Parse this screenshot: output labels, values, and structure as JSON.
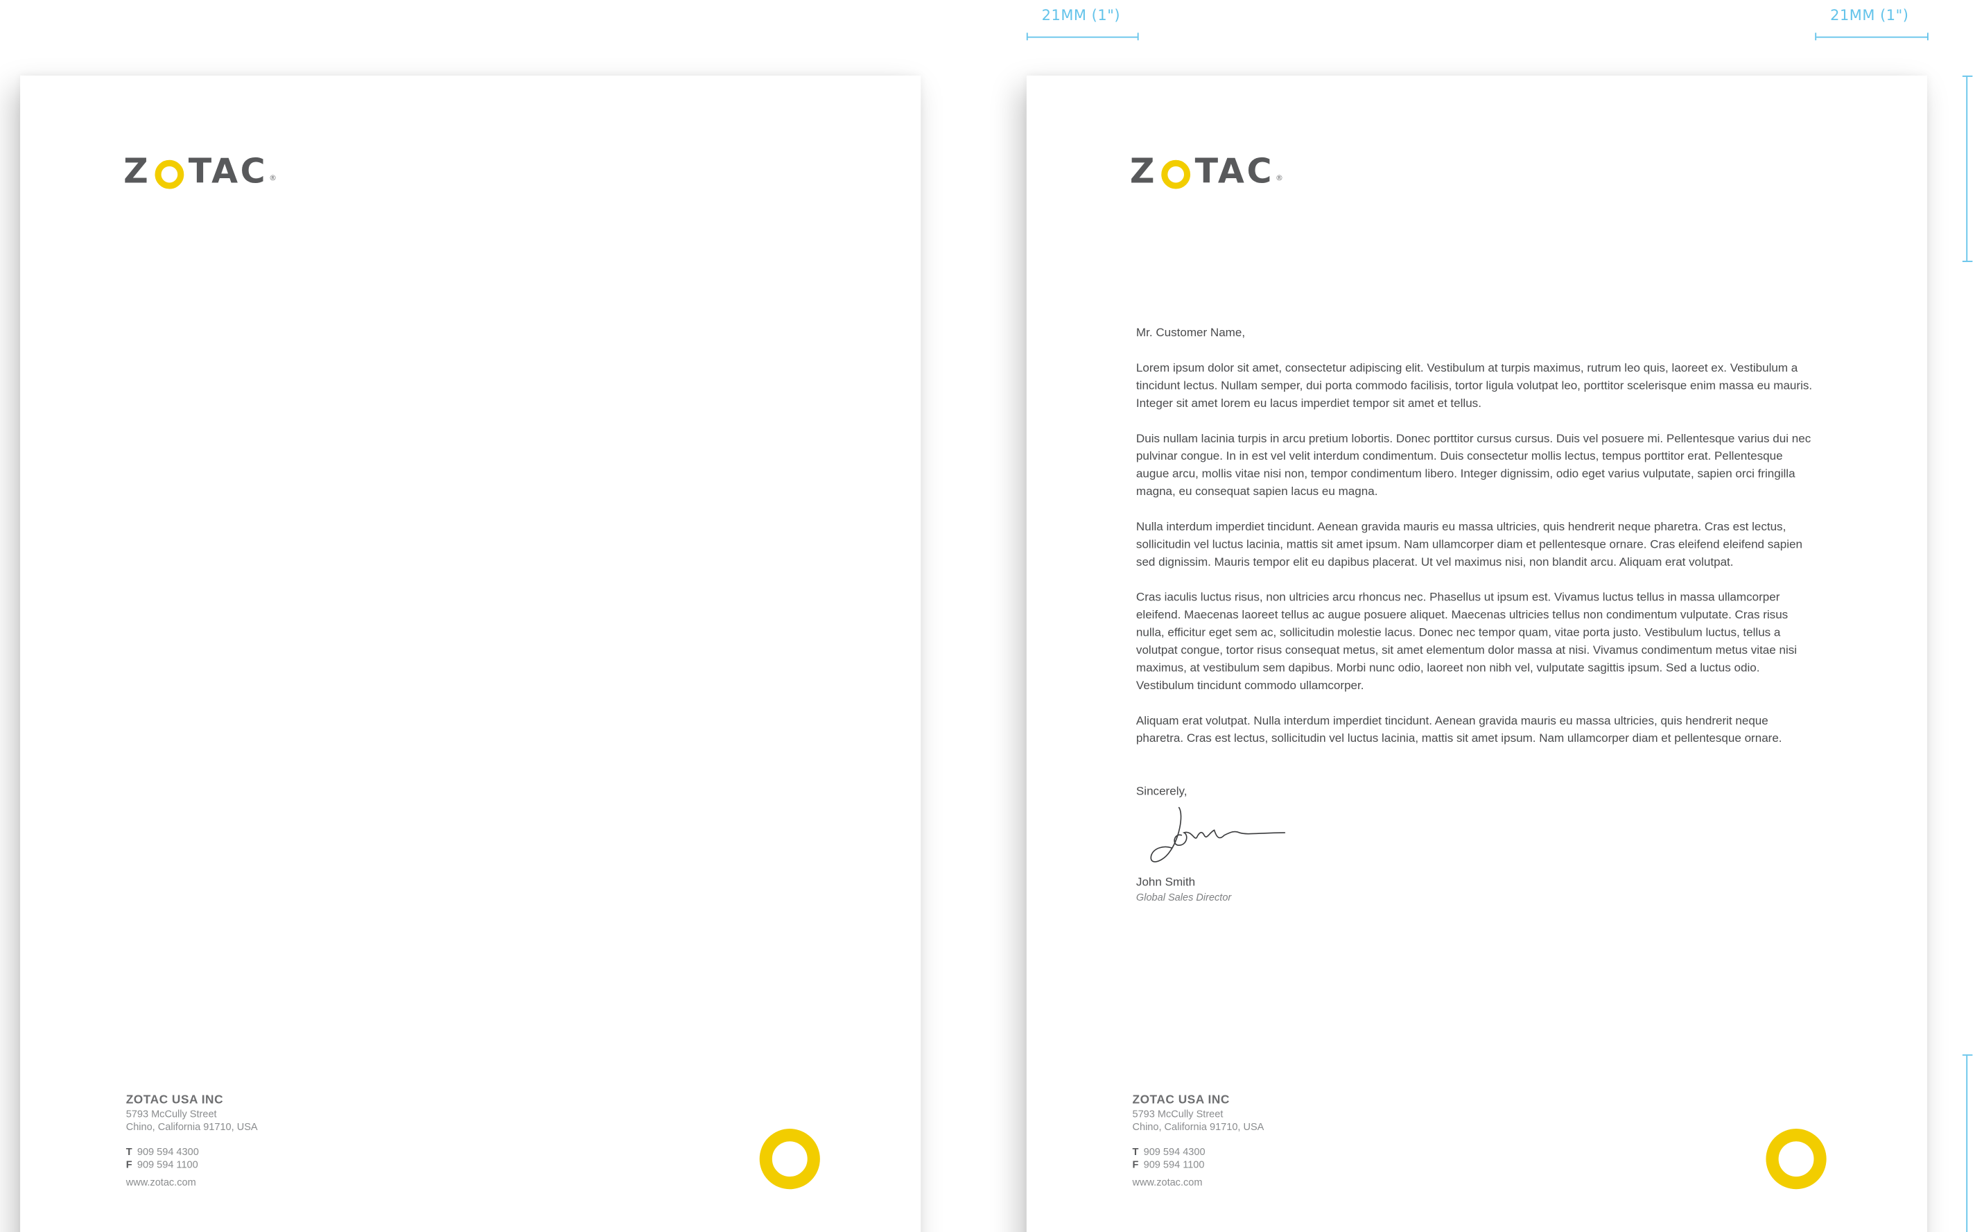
{
  "brand": {
    "logo_text_before": "Z",
    "logo_text_after": "TAC",
    "registered": "®",
    "accent_color": "#f2cd00",
    "logo_gray": "#58595b",
    "dimension_color": "#63c3ea"
  },
  "dimensions": {
    "left_margin_label": "21MM (1\")",
    "right_margin_label": "21MM (1\")"
  },
  "footer": {
    "company": "ZOTAC USA INC",
    "street": "5793 McCully Street",
    "city": "Chino, California 91710, USA",
    "phone_label": "T",
    "phone": "909 594 4300",
    "fax_label": "F",
    "fax": "909 594 1100",
    "website": "www.zotac.com"
  },
  "letter": {
    "salutation": "Mr. Customer Name,",
    "paragraphs": [
      "Lorem ipsum dolor sit amet, consectetur adipiscing elit. Vestibulum at turpis maximus, rutrum leo quis, laoreet ex. Vestibulum a tincidunt lectus. Nullam semper, dui porta commodo facilisis, tortor ligula volutpat leo, porttitor scelerisque enim massa eu mauris. Integer sit amet lorem eu lacus imperdiet tempor sit amet et tellus.",
      "Duis nullam lacinia turpis in arcu pretium lobortis. Donec porttitor cursus cursus. Duis vel posuere mi. Pellentesque varius dui nec pulvinar congue. In in est vel velit interdum condimentum. Duis consectetur mollis lectus, tempus porttitor erat. Pellentesque augue arcu, mollis vitae nisi non, tempor condimentum libero. Integer dignissim, odio eget varius vulputate, sapien orci fringilla magna, eu consequat sapien lacus eu magna.",
      "Nulla interdum imperdiet tincidunt. Aenean gravida mauris eu massa ultricies, quis hendrerit neque pharetra. Cras est lectus, sollicitudin vel luctus lacinia, mattis sit amet ipsum. Nam ullamcorper diam et pellentesque ornare. Cras eleifend eleifend sapien sed dignissim. Mauris tempor elit eu dapibus placerat. Ut vel maximus nisi, non blandit arcu. Aliquam erat volutpat.",
      "Cras iaculis luctus risus, non ultricies arcu rhoncus nec. Phasellus ut ipsum est. Vivamus luctus tellus in massa ullamcorper eleifend. Maecenas laoreet tellus ac augue posuere aliquet. Maecenas ultricies tellus non condimentum vulputate. Cras risus nulla, efficitur eget sem ac, sollicitudin molestie lacus. Donec nec tempor quam, vitae porta justo. Vestibulum luctus, tellus a volutpat congue, tortor risus consequat metus, sit amet elementum dolor massa at nisi. Vivamus condimentum metus vitae nisi maximus, at vestibulum sem dapibus. Morbi nunc odio, laoreet non nibh vel, vulputate sagittis ipsum. Sed a luctus odio. Vestibulum tincidunt commodo ullamcorper.",
      "Aliquam erat volutpat. Nulla interdum imperdiet tincidunt. Aenean gravida mauris eu massa ultricies, quis hendrerit neque pharetra. Cras est lectus, sollicitudin vel luctus lacinia, mattis sit amet ipsum. Nam ullamcorper diam et pellentesque ornare."
    ],
    "closing": "Sincerely,",
    "signer_name": "John Smith",
    "signer_title": "Global Sales Director"
  }
}
